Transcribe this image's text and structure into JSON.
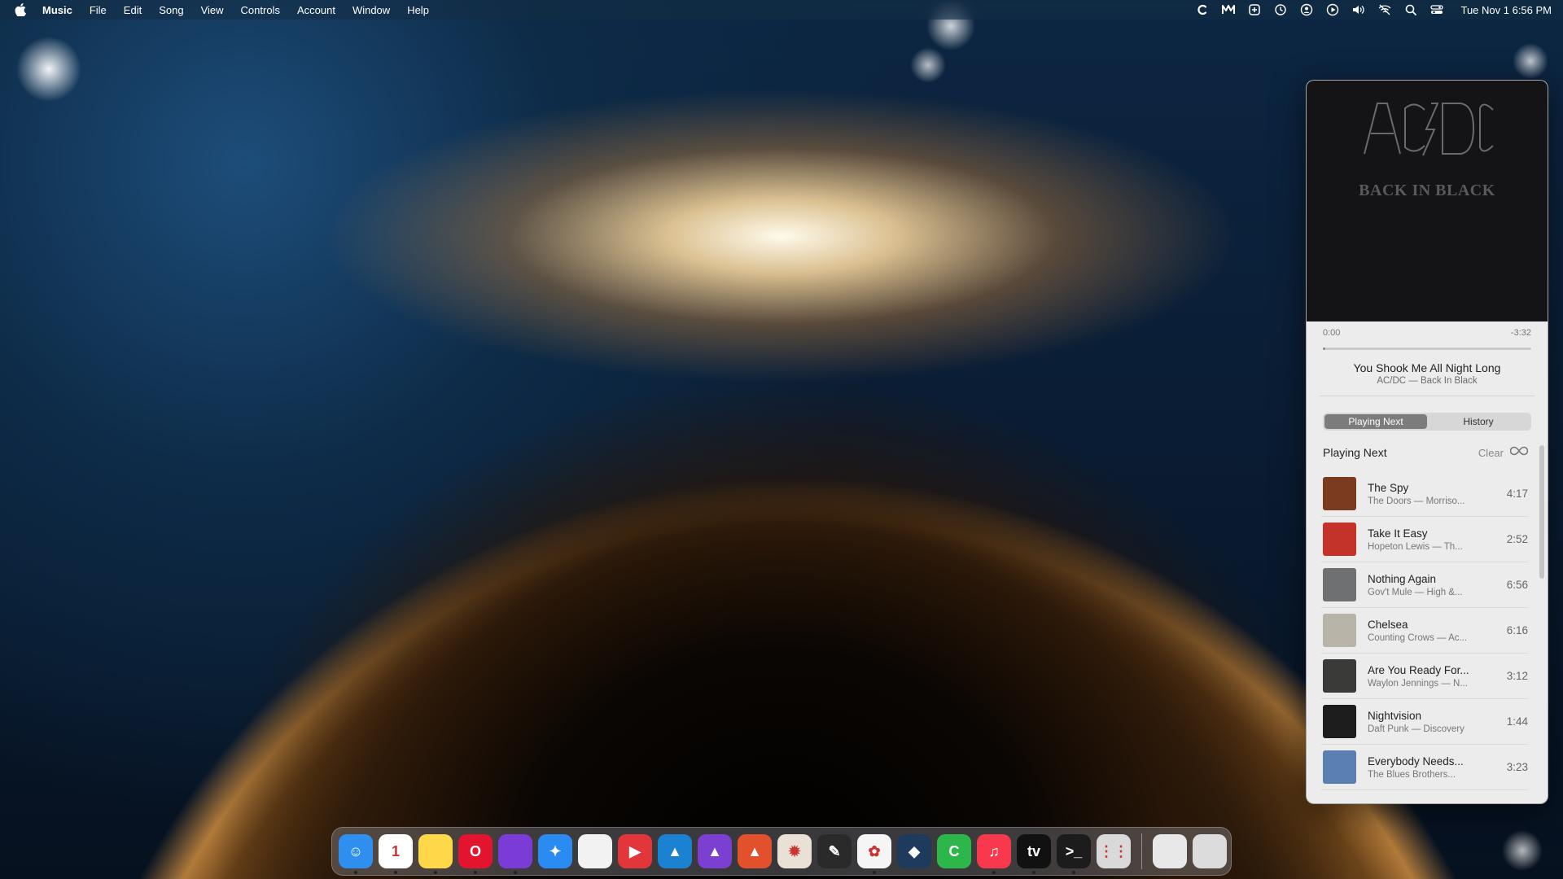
{
  "menubar": {
    "app_name": "Music",
    "items": [
      "File",
      "Edit",
      "Song",
      "View",
      "Controls",
      "Account",
      "Window",
      "Help"
    ],
    "status_icons": [
      "c-app-icon",
      "m-app-icon",
      "control-icon",
      "time-machine-icon",
      "user-icon",
      "play-circle-icon",
      "volume-icon",
      "wifi-off-icon",
      "search-icon",
      "control-center-icon"
    ],
    "clock": "Tue Nov 1  6:56 PM"
  },
  "player": {
    "artwork": {
      "band": "AC/DC",
      "album": "BACK IN BLACK"
    },
    "elapsed": "0:00",
    "remaining": "-3:32",
    "progress_fraction": 0.01,
    "now_playing": {
      "title": "You Shook Me All Night Long",
      "subtitle": "AC/DC — Back In Black"
    },
    "tabs": [
      {
        "label": "Playing Next",
        "active": true
      },
      {
        "label": "History",
        "active": false
      }
    ],
    "queue_title": "Playing Next",
    "clear_label": "Clear",
    "queue": [
      {
        "title": "The Spy",
        "subtitle": "The Doors — Morriso...",
        "duration": "4:17",
        "art": "#7a3b1f"
      },
      {
        "title": "Take It Easy",
        "subtitle": "Hopeton Lewis — Th...",
        "duration": "2:52",
        "art": "#c4332a"
      },
      {
        "title": "Nothing Again",
        "subtitle": "Gov't Mule — High &...",
        "duration": "6:56",
        "art": "#6f7072"
      },
      {
        "title": "Chelsea",
        "subtitle": "Counting Crows — Ac...",
        "duration": "6:16",
        "art": "#b9b4a8"
      },
      {
        "title": "Are You Ready For...",
        "subtitle": "Waylon Jennings — N...",
        "duration": "3:12",
        "art": "#3a3a38"
      },
      {
        "title": "Nightvision",
        "subtitle": "Daft Punk — Discovery",
        "duration": "1:44",
        "art": "#1d1d1d"
      },
      {
        "title": "Everybody Needs...",
        "subtitle": "The Blues Brothers...",
        "duration": "3:23",
        "art": "#5a7fb0"
      }
    ]
  },
  "dock": {
    "apps": [
      {
        "name": "finder-icon",
        "color": "#2e8ff0",
        "running": true,
        "glyph": "☺"
      },
      {
        "name": "calendar-icon",
        "color": "#ffffff",
        "running": true,
        "glyph": "1"
      },
      {
        "name": "notes-icon",
        "color": "#ffd84a",
        "running": true,
        "glyph": ""
      },
      {
        "name": "opera-icon",
        "color": "#e3142d",
        "running": true,
        "glyph": "O"
      },
      {
        "name": "firefox-icon",
        "color": "#7a3bd6",
        "running": true,
        "glyph": ""
      },
      {
        "name": "safari-icon",
        "color": "#2a8bf2",
        "running": false,
        "glyph": "✦"
      },
      {
        "name": "document-icon",
        "color": "#f2f2f2",
        "running": false,
        "glyph": ""
      },
      {
        "name": "pdf-expert-icon",
        "color": "#e3363a",
        "running": false,
        "glyph": "▶"
      },
      {
        "name": "affinity-designer-icon",
        "color": "#1b82d2",
        "running": false,
        "glyph": "▲"
      },
      {
        "name": "affinity-photo-icon",
        "color": "#7b3fd1",
        "running": false,
        "glyph": "▲"
      },
      {
        "name": "affinity-publisher-icon",
        "color": "#e2502c",
        "running": false,
        "glyph": "▲"
      },
      {
        "name": "pixelmator-icon",
        "color": "#e9e1d5",
        "running": false,
        "glyph": "✹"
      },
      {
        "name": "vectorize-icon",
        "color": "#2a2a2a",
        "running": false,
        "glyph": "✎"
      },
      {
        "name": "photos-icon",
        "color": "#f5f5f5",
        "running": true,
        "glyph": "✿"
      },
      {
        "name": "layers-icon",
        "color": "#1e3a5c",
        "running": false,
        "glyph": "◆"
      },
      {
        "name": "camtasia-icon",
        "color": "#2db74a",
        "running": false,
        "glyph": "C"
      },
      {
        "name": "music-icon",
        "color": "#f8394d",
        "running": true,
        "glyph": "♫"
      },
      {
        "name": "apple-tv-icon",
        "color": "#111111",
        "running": true,
        "glyph": "tv"
      },
      {
        "name": "terminal-icon",
        "color": "#1c1c1c",
        "running": true,
        "glyph": ">_"
      },
      {
        "name": "launchpad-icon",
        "color": "#d9d9d9",
        "running": false,
        "glyph": "⋮⋮"
      },
      {
        "name": "downloads-icon",
        "color": "#e8e8e8",
        "running": false,
        "glyph": ""
      },
      {
        "name": "trash-icon",
        "color": "#dcdcdc",
        "running": false,
        "glyph": ""
      }
    ]
  }
}
